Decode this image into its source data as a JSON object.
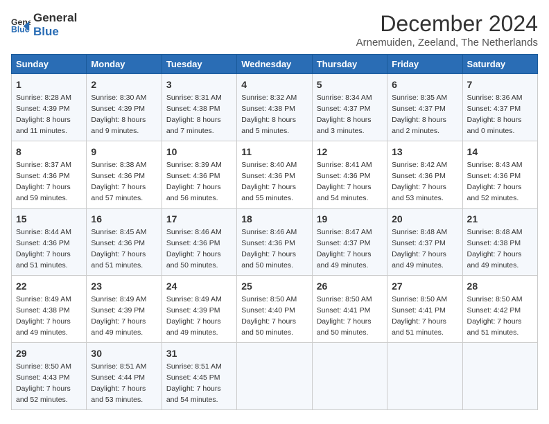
{
  "logo": {
    "line1": "General",
    "line2": "Blue"
  },
  "title": "December 2024",
  "subtitle": "Arnemuiden, Zeeland, The Netherlands",
  "weekdays": [
    "Sunday",
    "Monday",
    "Tuesday",
    "Wednesday",
    "Thursday",
    "Friday",
    "Saturday"
  ],
  "weeks": [
    [
      {
        "day": "1",
        "sunrise": "8:28 AM",
        "sunset": "4:39 PM",
        "daylight": "8 hours and 11 minutes."
      },
      {
        "day": "2",
        "sunrise": "8:30 AM",
        "sunset": "4:39 PM",
        "daylight": "8 hours and 9 minutes."
      },
      {
        "day": "3",
        "sunrise": "8:31 AM",
        "sunset": "4:38 PM",
        "daylight": "8 hours and 7 minutes."
      },
      {
        "day": "4",
        "sunrise": "8:32 AM",
        "sunset": "4:38 PM",
        "daylight": "8 hours and 5 minutes."
      },
      {
        "day": "5",
        "sunrise": "8:34 AM",
        "sunset": "4:37 PM",
        "daylight": "8 hours and 3 minutes."
      },
      {
        "day": "6",
        "sunrise": "8:35 AM",
        "sunset": "4:37 PM",
        "daylight": "8 hours and 2 minutes."
      },
      {
        "day": "7",
        "sunrise": "8:36 AM",
        "sunset": "4:37 PM",
        "daylight": "8 hours and 0 minutes."
      }
    ],
    [
      {
        "day": "8",
        "sunrise": "8:37 AM",
        "sunset": "4:36 PM",
        "daylight": "7 hours and 59 minutes."
      },
      {
        "day": "9",
        "sunrise": "8:38 AM",
        "sunset": "4:36 PM",
        "daylight": "7 hours and 57 minutes."
      },
      {
        "day": "10",
        "sunrise": "8:39 AM",
        "sunset": "4:36 PM",
        "daylight": "7 hours and 56 minutes."
      },
      {
        "day": "11",
        "sunrise": "8:40 AM",
        "sunset": "4:36 PM",
        "daylight": "7 hours and 55 minutes."
      },
      {
        "day": "12",
        "sunrise": "8:41 AM",
        "sunset": "4:36 PM",
        "daylight": "7 hours and 54 minutes."
      },
      {
        "day": "13",
        "sunrise": "8:42 AM",
        "sunset": "4:36 PM",
        "daylight": "7 hours and 53 minutes."
      },
      {
        "day": "14",
        "sunrise": "8:43 AM",
        "sunset": "4:36 PM",
        "daylight": "7 hours and 52 minutes."
      }
    ],
    [
      {
        "day": "15",
        "sunrise": "8:44 AM",
        "sunset": "4:36 PM",
        "daylight": "7 hours and 51 minutes."
      },
      {
        "day": "16",
        "sunrise": "8:45 AM",
        "sunset": "4:36 PM",
        "daylight": "7 hours and 51 minutes."
      },
      {
        "day": "17",
        "sunrise": "8:46 AM",
        "sunset": "4:36 PM",
        "daylight": "7 hours and 50 minutes."
      },
      {
        "day": "18",
        "sunrise": "8:46 AM",
        "sunset": "4:36 PM",
        "daylight": "7 hours and 50 minutes."
      },
      {
        "day": "19",
        "sunrise": "8:47 AM",
        "sunset": "4:37 PM",
        "daylight": "7 hours and 49 minutes."
      },
      {
        "day": "20",
        "sunrise": "8:48 AM",
        "sunset": "4:37 PM",
        "daylight": "7 hours and 49 minutes."
      },
      {
        "day": "21",
        "sunrise": "8:48 AM",
        "sunset": "4:38 PM",
        "daylight": "7 hours and 49 minutes."
      }
    ],
    [
      {
        "day": "22",
        "sunrise": "8:49 AM",
        "sunset": "4:38 PM",
        "daylight": "7 hours and 49 minutes."
      },
      {
        "day": "23",
        "sunrise": "8:49 AM",
        "sunset": "4:39 PM",
        "daylight": "7 hours and 49 minutes."
      },
      {
        "day": "24",
        "sunrise": "8:49 AM",
        "sunset": "4:39 PM",
        "daylight": "7 hours and 49 minutes."
      },
      {
        "day": "25",
        "sunrise": "8:50 AM",
        "sunset": "4:40 PM",
        "daylight": "7 hours and 50 minutes."
      },
      {
        "day": "26",
        "sunrise": "8:50 AM",
        "sunset": "4:41 PM",
        "daylight": "7 hours and 50 minutes."
      },
      {
        "day": "27",
        "sunrise": "8:50 AM",
        "sunset": "4:41 PM",
        "daylight": "7 hours and 51 minutes."
      },
      {
        "day": "28",
        "sunrise": "8:50 AM",
        "sunset": "4:42 PM",
        "daylight": "7 hours and 51 minutes."
      }
    ],
    [
      {
        "day": "29",
        "sunrise": "8:50 AM",
        "sunset": "4:43 PM",
        "daylight": "7 hours and 52 minutes."
      },
      {
        "day": "30",
        "sunrise": "8:51 AM",
        "sunset": "4:44 PM",
        "daylight": "7 hours and 53 minutes."
      },
      {
        "day": "31",
        "sunrise": "8:51 AM",
        "sunset": "4:45 PM",
        "daylight": "7 hours and 54 minutes."
      },
      null,
      null,
      null,
      null
    ]
  ]
}
